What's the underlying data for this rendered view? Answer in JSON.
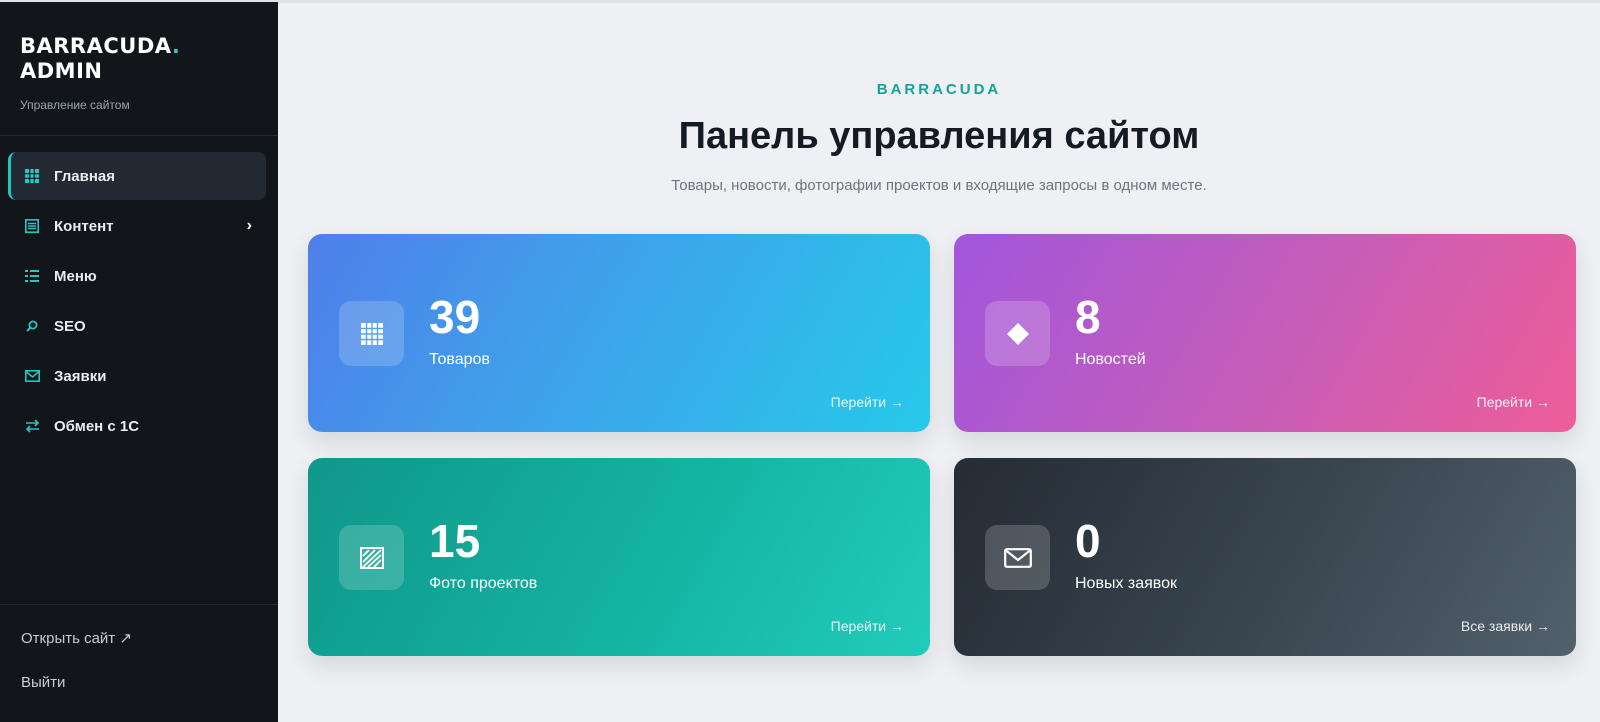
{
  "brand": {
    "title_line1": "BARRACUDA",
    "title_dot": ".",
    "title_line2": "ADMIN",
    "subtitle": "Управление сайтом",
    "accent_color": "#22c7c0"
  },
  "sidebar": {
    "items": [
      {
        "label": "Главная",
        "icon": "grid-icon",
        "active": true
      },
      {
        "label": "Контент",
        "icon": "list-icon",
        "has_submenu": true,
        "chevron": "›"
      },
      {
        "label": "Меню",
        "icon": "menu-list-icon"
      },
      {
        "label": "SEO",
        "icon": "search-icon"
      },
      {
        "label": "Заявки",
        "icon": "mail-icon"
      },
      {
        "label": "Обмен с 1С",
        "icon": "exchange-icon"
      }
    ],
    "bottom": {
      "open_site": "Открыть сайт ↗",
      "logout": "Выйти"
    }
  },
  "main": {
    "eyebrow": "BARRACUDA",
    "title": "Панель управления сайтом",
    "subtitle": "Товары, новости, фотографии проектов и входящие запросы в одном месте."
  },
  "cards": [
    {
      "value": "39",
      "label": "Товаров",
      "link": "Перейти →",
      "icon": "grid-icon",
      "gradient": [
        "#4f7fea",
        "#26c9e9"
      ]
    },
    {
      "value": "8",
      "label": "Новостей",
      "link": "Перейти →",
      "icon": "diamond-icon",
      "gradient": [
        "#a256dc",
        "#ee5d98"
      ]
    },
    {
      "value": "15",
      "label": "Фото проектов",
      "link": "Перейти →",
      "icon": "photo-icon",
      "gradient": [
        "#0f978a",
        "#21ccbb"
      ]
    },
    {
      "value": "0",
      "label": "Новых заявок",
      "link": "Все заявки →",
      "icon": "mail-icon",
      "gradient": [
        "#242c35",
        "#53616d"
      ]
    }
  ]
}
